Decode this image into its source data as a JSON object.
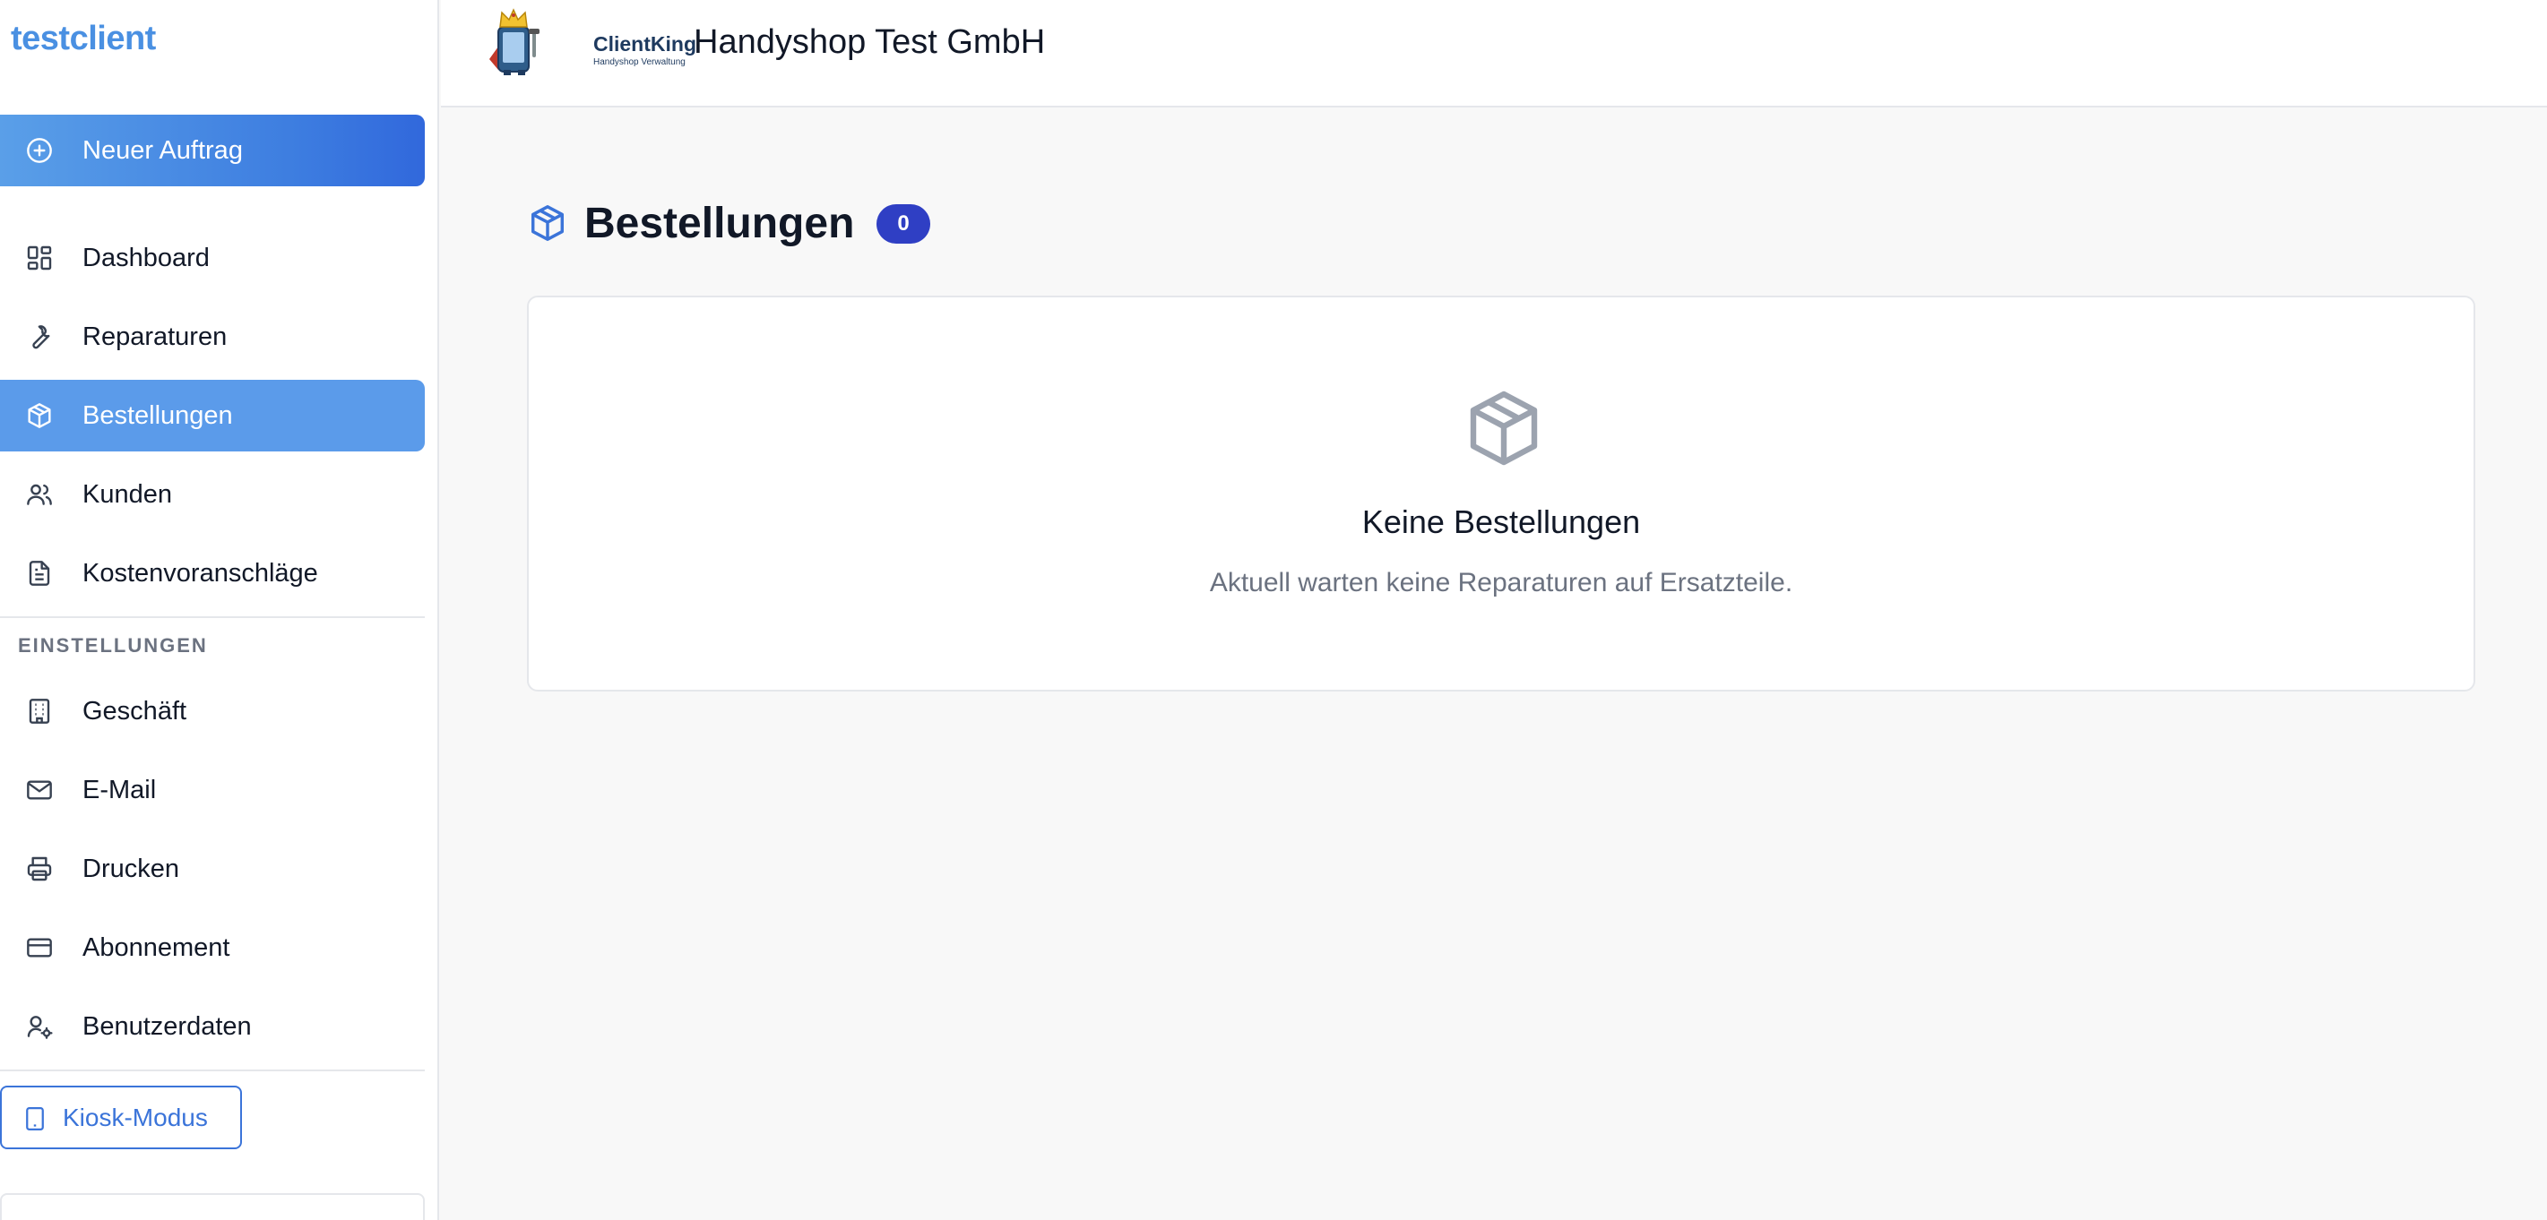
{
  "sidebar": {
    "brand": "testclient",
    "new_order": "Neuer Auftrag",
    "nav": [
      {
        "label": "Dashboard",
        "icon": "dashboard-icon"
      },
      {
        "label": "Reparaturen",
        "icon": "wrench-icon"
      },
      {
        "label": "Bestellungen",
        "icon": "box-icon",
        "active": true
      },
      {
        "label": "Kunden",
        "icon": "users-icon"
      },
      {
        "label": "Kostenvoranschläge",
        "icon": "document-icon"
      }
    ],
    "settings_heading": "EINSTELLUNGEN",
    "settings": [
      {
        "label": "Geschäft",
        "icon": "building-icon"
      },
      {
        "label": "E-Mail",
        "icon": "mail-icon"
      },
      {
        "label": "Drucken",
        "icon": "printer-icon"
      },
      {
        "label": "Abonnement",
        "icon": "credit-card-icon"
      },
      {
        "label": "Benutzerdaten",
        "icon": "user-settings-icon"
      }
    ],
    "kiosk": "Kiosk-Modus"
  },
  "header": {
    "logo_name": "ClientKing",
    "logo_sub": "Handyshop Verwaltung",
    "company": "Handyshop Test GmbH"
  },
  "main": {
    "title": "Bestellungen",
    "count": "0",
    "empty_title": "Keine Bestellungen",
    "empty_text": "Aktuell warten keine Reparaturen auf Ersatzteile."
  },
  "colors": {
    "accent": "#3b74d9",
    "active_nav": "#5b9bea",
    "badge": "#2f3fc4",
    "brand": "#4a90e2"
  }
}
